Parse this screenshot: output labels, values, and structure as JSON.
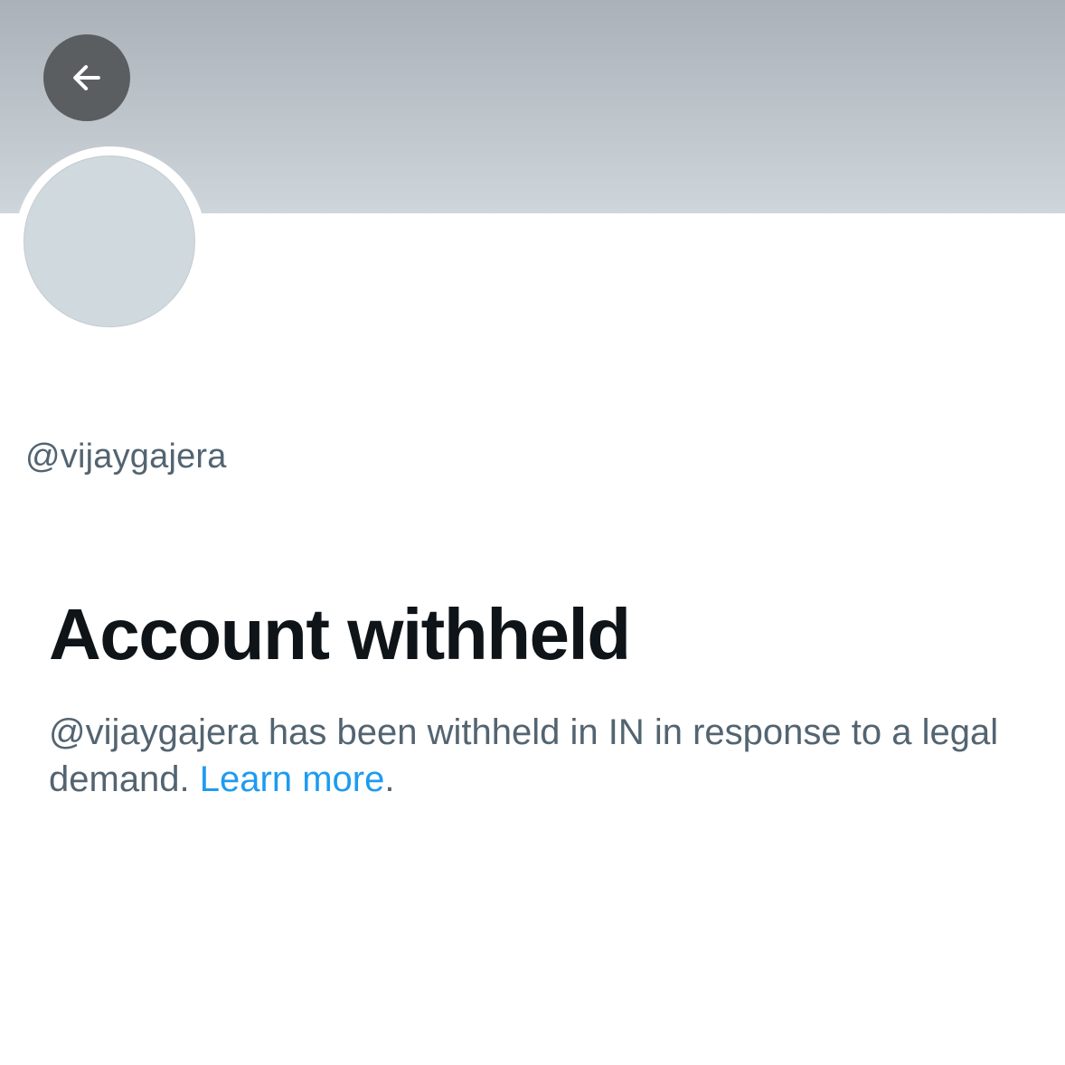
{
  "header": {
    "back_icon": "arrow-left-icon"
  },
  "profile": {
    "handle": "@vijaygajera"
  },
  "withheld": {
    "title": "Account withheld",
    "message_prefix": "@vijaygajera has been withheld in IN in response to a legal demand. ",
    "learn_more_label": "Learn more",
    "message_suffix": "."
  },
  "colors": {
    "banner_top": "#aab1b8",
    "banner_bottom": "#cfd6db",
    "back_button_bg": "#5b5e61",
    "avatar_fill": "#cfd9de",
    "title_text": "#0f1419",
    "secondary_text": "#536471",
    "link": "#1d9bf0"
  }
}
